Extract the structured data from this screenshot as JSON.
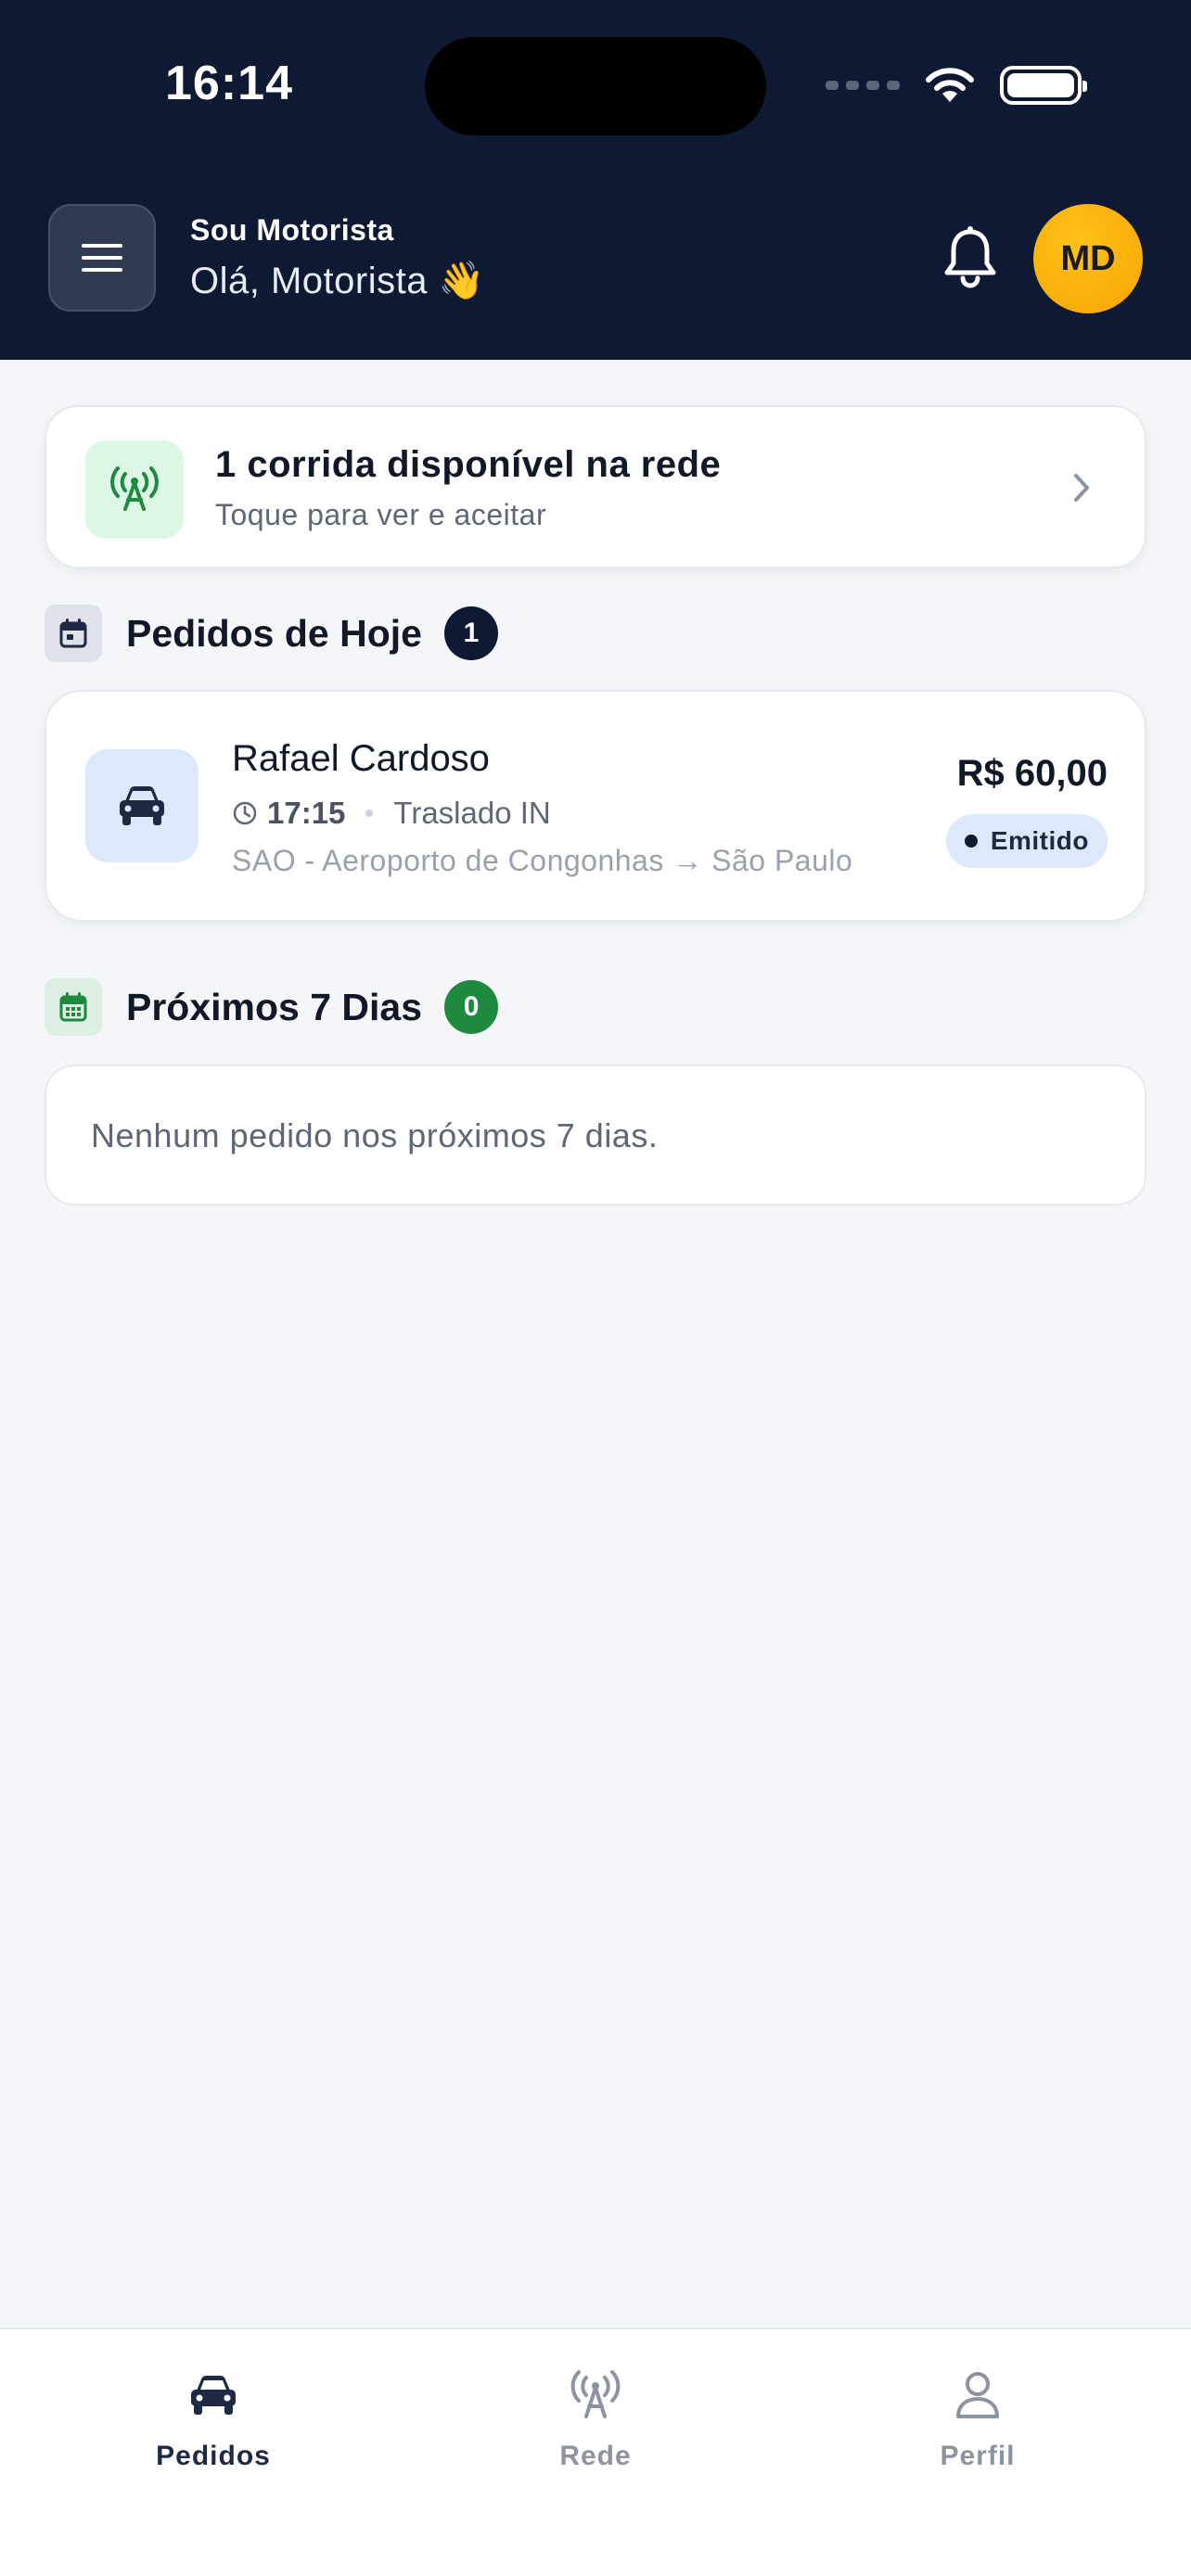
{
  "status_bar": {
    "time": "16:14"
  },
  "header": {
    "brand": "Sou Motorista",
    "greeting": "Olá, Motorista",
    "greeting_emoji": "👋",
    "avatar_initials": "MD"
  },
  "network_banner": {
    "title": "1 corrida disponível na rede",
    "subtitle": "Toque para ver e aceitar"
  },
  "today": {
    "title": "Pedidos de Hoje",
    "count": "1",
    "orders": [
      {
        "name": "Rafael Cardoso",
        "time": "17:15",
        "type": "Traslado IN",
        "route": "SAO - Aeroporto de Congonhas → São Paulo",
        "price": "R$ 60,00",
        "status": "Emitido"
      }
    ]
  },
  "next7": {
    "title": "Próximos 7 Dias",
    "count": "0",
    "empty_message": "Nenhum pedido nos próximos 7 dias."
  },
  "bottom_nav": {
    "items": [
      {
        "label": "Pedidos",
        "icon": "car-icon",
        "active": true
      },
      {
        "label": "Rede",
        "icon": "antenna-icon",
        "active": false
      },
      {
        "label": "Perfil",
        "icon": "user-icon",
        "active": false
      }
    ]
  },
  "colors": {
    "header_bg": "#0e1a33",
    "accent_amber": "#f7a400",
    "success_green": "#1e8a3e",
    "navy_badge": "#0e1a33",
    "inactive_gray": "#8d94a1"
  }
}
